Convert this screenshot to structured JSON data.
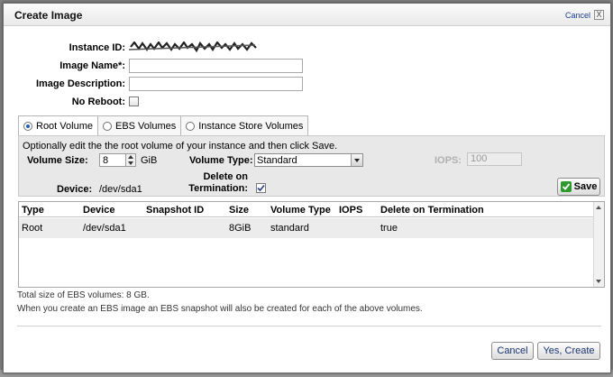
{
  "dialog": {
    "title": "Create Image",
    "cancel_link": "Cancel",
    "close_glyph": "X"
  },
  "form": {
    "instance_id_label": "Instance ID:",
    "image_name_label": "Image Name*:",
    "image_name_value": "",
    "image_description_label": "Image Description:",
    "image_description_value": "",
    "no_reboot_label": "No Reboot:",
    "no_reboot_checked": false
  },
  "tabs": [
    {
      "label": "Root Volume",
      "selected": true
    },
    {
      "label": "EBS Volumes",
      "selected": false
    },
    {
      "label": "Instance Store Volumes",
      "selected": false
    }
  ],
  "root_panel": {
    "instructions": "Optionally edit the the root volume of your instance and then click Save.",
    "volume_size_label": "Volume Size:",
    "volume_size_value": "8",
    "volume_size_unit": "GiB",
    "volume_type_label": "Volume Type:",
    "volume_type_value": "Standard",
    "iops_label": "IOPS:",
    "iops_value": "100",
    "device_label": "Device:",
    "device_value": "/dev/sda1",
    "delete_on_termination_label_1": "Delete on",
    "delete_on_termination_label_2": "Termination:",
    "delete_on_termination_checked": true,
    "save_button": "Save"
  },
  "volumes_table": {
    "columns": [
      "Type",
      "Device",
      "Snapshot ID",
      "Size",
      "Volume Type",
      "IOPS",
      "Delete on Termination"
    ],
    "rows": [
      {
        "type": "Root",
        "device": "/dev/sda1",
        "snapshot_id": "",
        "size": "8GiB",
        "volume_type": "standard",
        "iops": "",
        "delete_on_termination": "true"
      }
    ]
  },
  "notes": {
    "total_size": "Total size of EBS volumes: 8 GB.",
    "snapshot_note": "When you create an EBS image an EBS snapshot will also be created for each of the above volumes."
  },
  "footer": {
    "cancel_button": "Cancel",
    "create_button": "Yes, Create"
  },
  "colors": {
    "link": "#1a3d8f",
    "panel_bg": "#e8e8e8",
    "save_check": "#2e9a2e"
  }
}
